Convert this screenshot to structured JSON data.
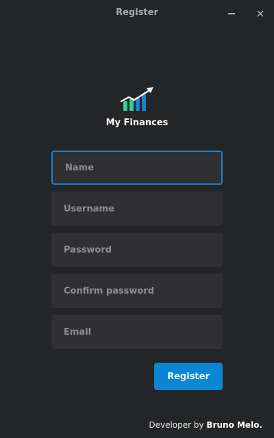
{
  "window": {
    "title": "Register",
    "minimize_icon": "minimize-icon",
    "close_icon": "close-icon"
  },
  "app": {
    "name": "My Finances",
    "logo_icon": "finance-chart-icon"
  },
  "form": {
    "name_placeholder": "Name",
    "name_value": "",
    "username_placeholder": "Username",
    "username_value": "",
    "password_placeholder": "Password",
    "password_value": "",
    "confirm_placeholder": "Confirm password",
    "confirm_value": "",
    "email_placeholder": "Email",
    "email_value": "",
    "register_label": "Register"
  },
  "footer": {
    "prefix": "Developer by ",
    "developer": "Bruno Melo."
  },
  "colors": {
    "background": "#242527",
    "field": "#303032",
    "focus_border": "#1f80d4",
    "accent": "#0b86d4",
    "logo_green": "#2fcf95",
    "logo_blue": "#1b7fd1"
  }
}
